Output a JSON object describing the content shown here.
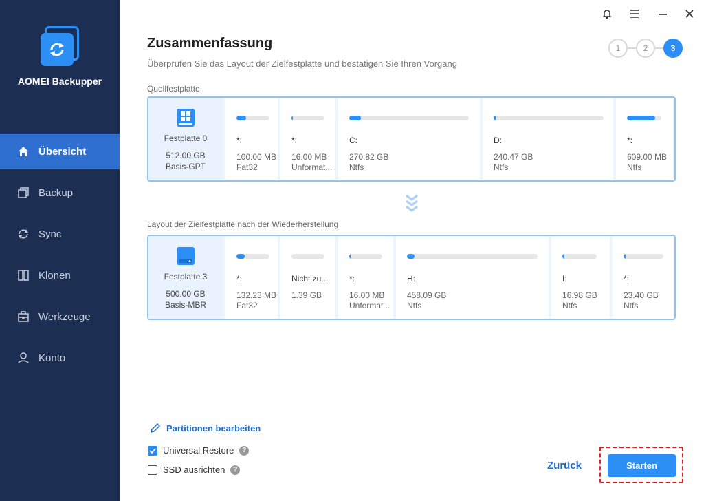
{
  "app": {
    "name": "AOMEI Backupper"
  },
  "nav": [
    {
      "label": "Übersicht",
      "icon": "home-icon",
      "active": true
    },
    {
      "label": "Backup",
      "icon": "backup-icon",
      "active": false
    },
    {
      "label": "Sync",
      "icon": "sync-icon",
      "active": false
    },
    {
      "label": "Klonen",
      "icon": "clone-icon",
      "active": false
    },
    {
      "label": "Werkzeuge",
      "icon": "tools-icon",
      "active": false
    },
    {
      "label": "Konto",
      "icon": "user-icon",
      "active": false
    }
  ],
  "header": {
    "title": "Zusammenfassung",
    "subtitle": "Überprüfen Sie das Layout der Zielfestplatte und bestätigen Sie Ihren Vorgang",
    "steps": [
      "1",
      "2",
      "3"
    ],
    "active_step": 3
  },
  "source": {
    "label": "Quellfestplatte",
    "disk": {
      "name": "Festplatte 0",
      "size": "512.00 GB",
      "type": "Basis-GPT"
    },
    "partitions": [
      {
        "letter": "*:",
        "size": "100.00 MB",
        "fs": "Fat32",
        "used": 0.3
      },
      {
        "letter": "*:",
        "size": "16.00 MB",
        "fs": "Unformat...",
        "used": 0.04
      },
      {
        "letter": "C:",
        "size": "270.82 GB",
        "fs": "Ntfs",
        "used": 0.1
      },
      {
        "letter": "D:",
        "size": "240.47 GB",
        "fs": "Ntfs",
        "used": 0.02
      },
      {
        "letter": "*:",
        "size": "609.00 MB",
        "fs": "Ntfs",
        "used": 0.82
      }
    ]
  },
  "target": {
    "label": "Layout der Zielfestplatte nach der Wiederherstellung",
    "disk": {
      "name": "Festplatte 3",
      "size": "500.00 GB",
      "type": "Basis-MBR"
    },
    "partitions": [
      {
        "letter": "*:",
        "size": "132.23 MB",
        "fs": "Fat32",
        "used": 0.24
      },
      {
        "letter": "Nicht zu...",
        "size": "1.39 GB",
        "fs": "",
        "used": 0
      },
      {
        "letter": "*:",
        "size": "16.00 MB",
        "fs": "Unformat...",
        "used": 0.05
      },
      {
        "letter": "H:",
        "size": "458.09 GB",
        "fs": "Ntfs",
        "used": 0.06
      },
      {
        "letter": "I:",
        "size": "16.98 GB",
        "fs": "Ntfs",
        "used": 0.05
      },
      {
        "letter": "*:",
        "size": "23.40 GB",
        "fs": "Ntfs",
        "used": 0.05
      }
    ]
  },
  "bottom": {
    "edit_label": "Partitionen bearbeiten",
    "universal_restore": {
      "label": "Universal Restore",
      "checked": true
    },
    "ssd_align": {
      "label": "SSD ausrichten",
      "checked": false
    },
    "help": "?",
    "back_label": "Zurück",
    "start_label": "Starten"
  },
  "colors": {
    "accent": "#2b8ff5",
    "sidebar": "#1c2f53",
    "highlight": "#e0201b"
  }
}
